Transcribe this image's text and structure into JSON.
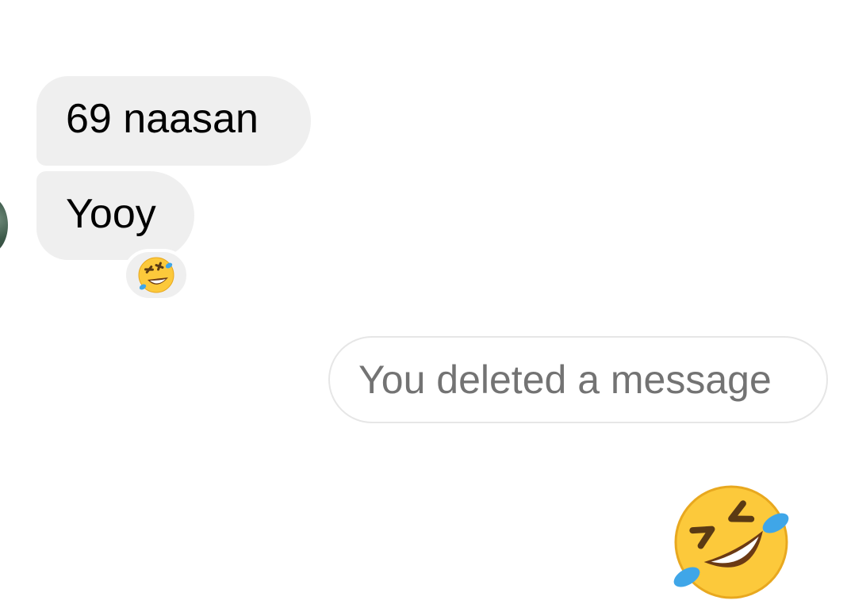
{
  "thread": {
    "messages": [
      {
        "text": "69 naasan"
      },
      {
        "text": "Yooy",
        "reaction": "rolling-on-the-floor-laughing-emoji"
      }
    ],
    "deleted_notice": "You deleted a message",
    "sent_emoji": "rolling-on-the-floor-laughing-emoji"
  },
  "colors": {
    "incoming_bubble": "#efefef",
    "deleted_border": "#e6e6e6",
    "deleted_text": "#737373",
    "emoji_face": "#fcc93b",
    "emoji_tear": "#3fa6e8"
  }
}
